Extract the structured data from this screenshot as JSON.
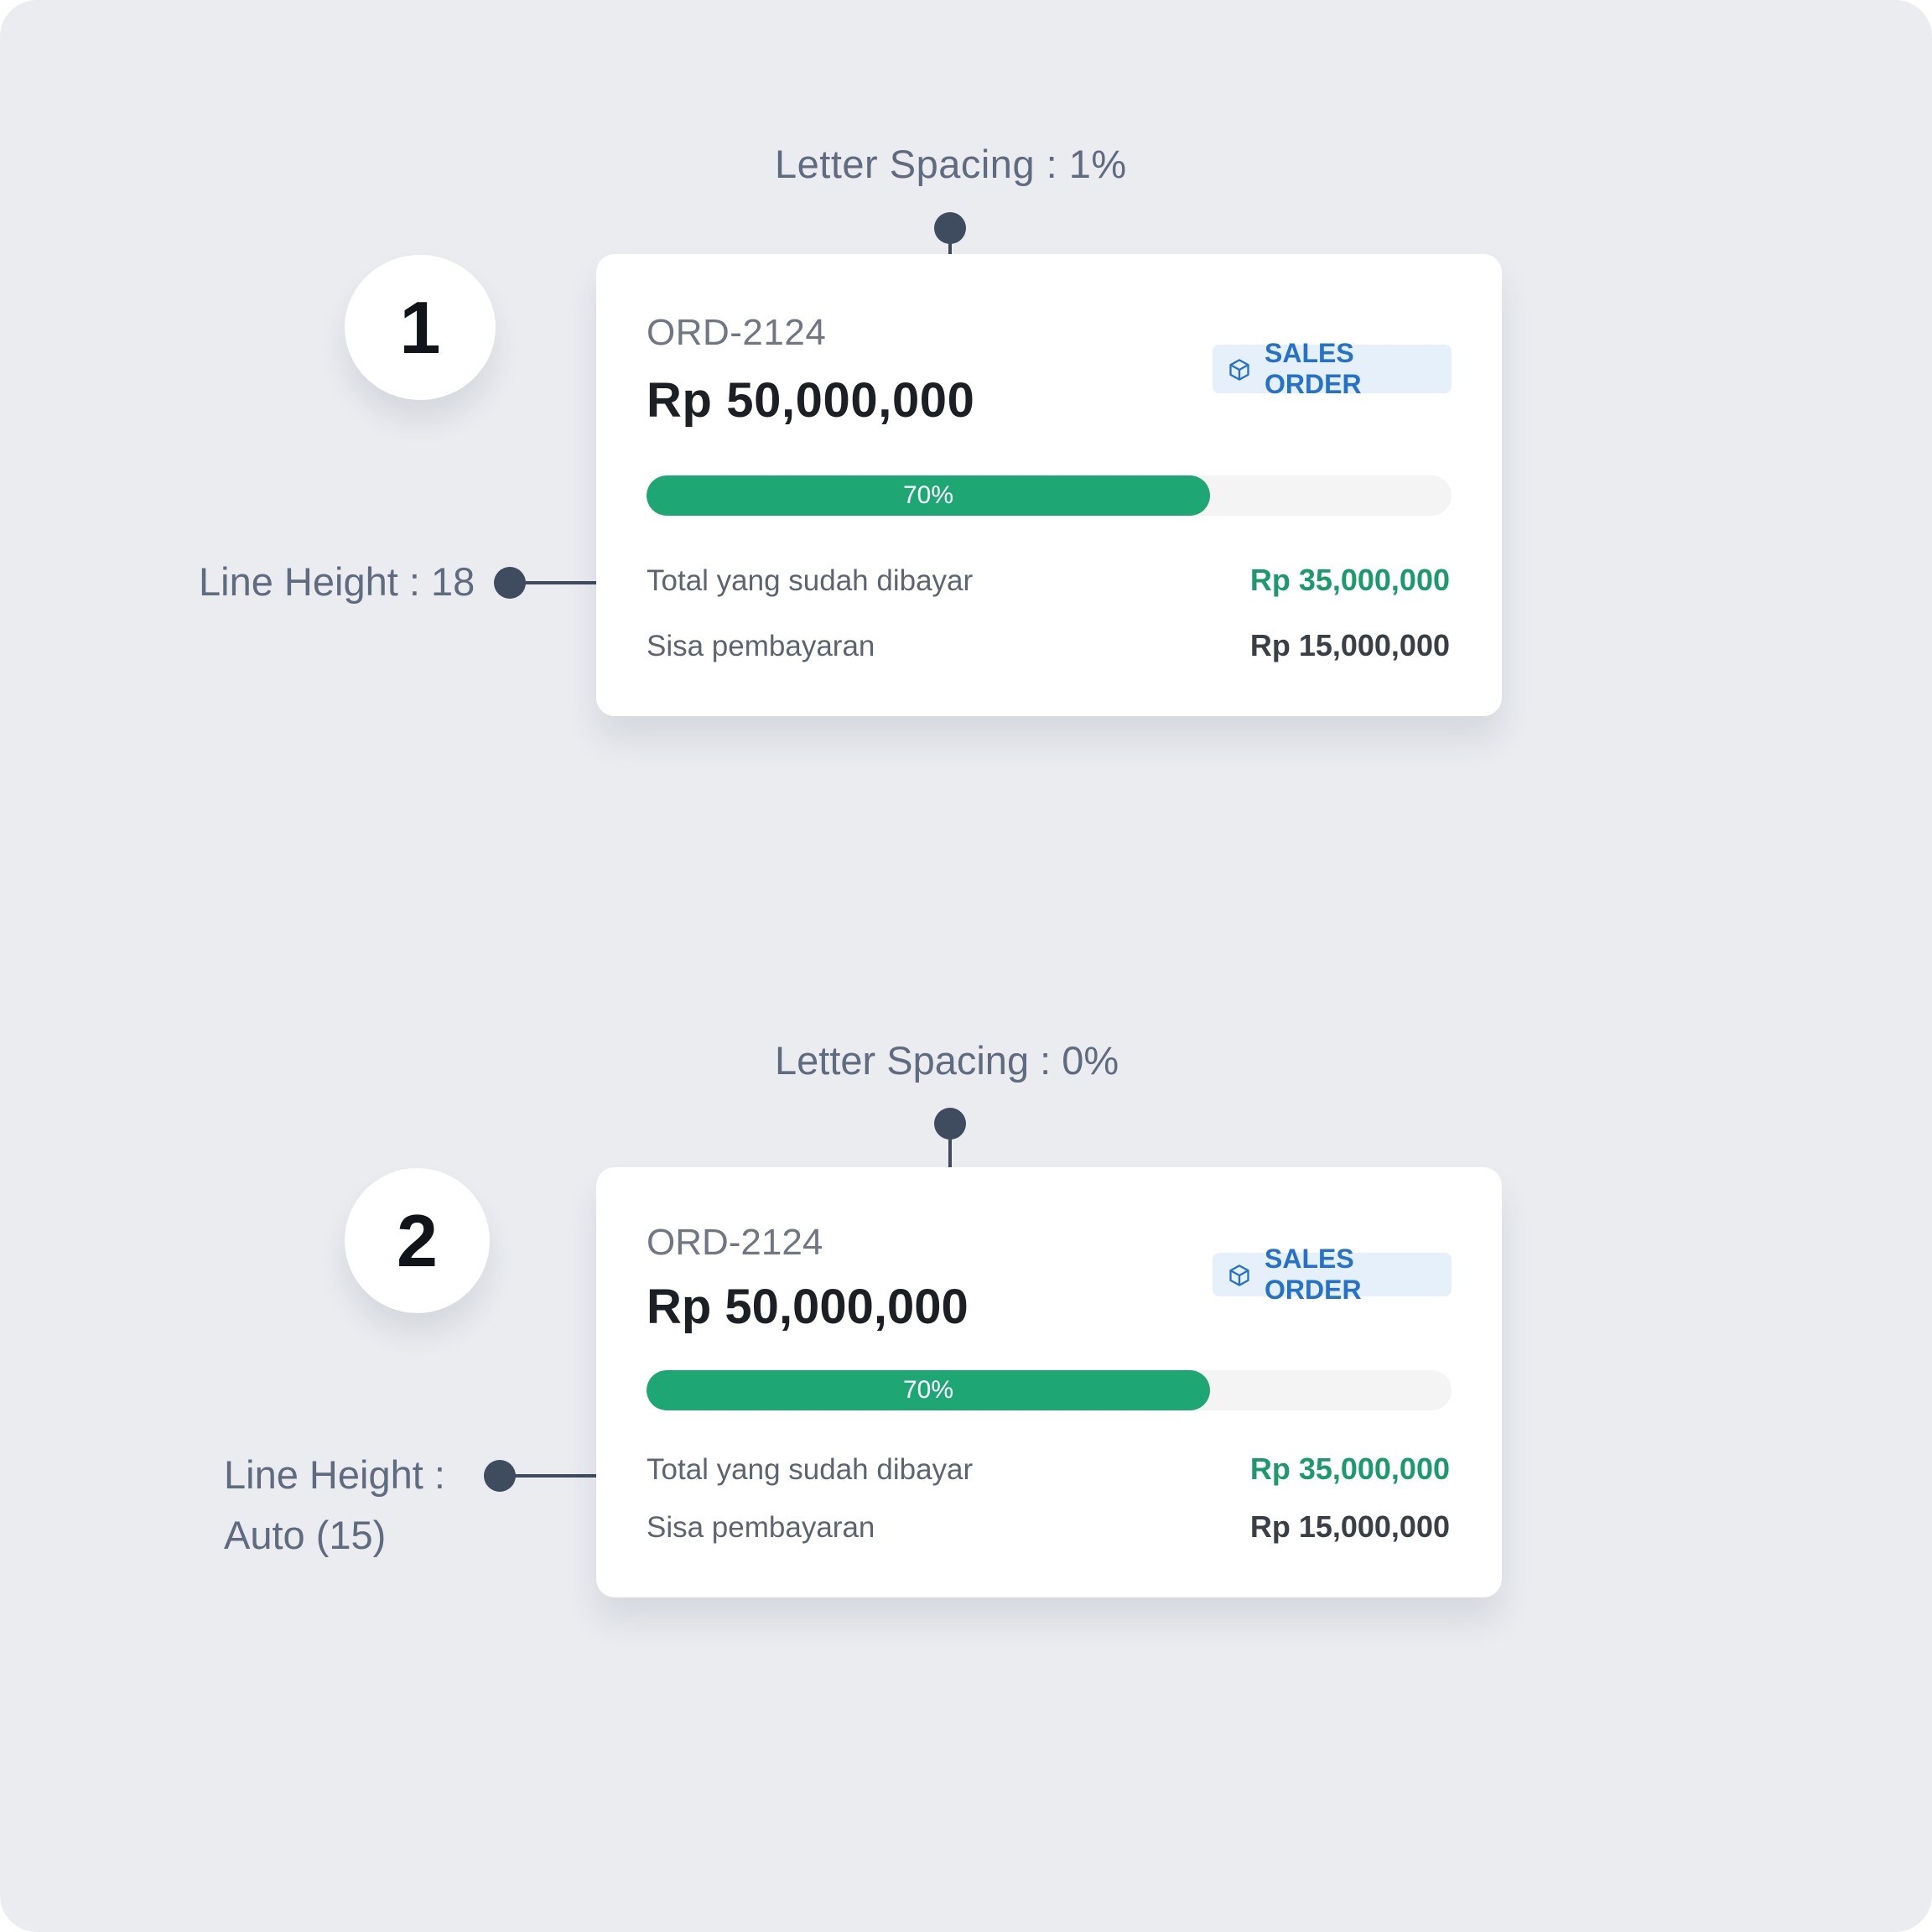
{
  "colors": {
    "background": "#eaecf0",
    "card": "#ffffff",
    "progress_fill": "#1fa675",
    "progress_track": "#f4f4f5",
    "badge_bg": "#e6f0fb",
    "badge_text": "#2672c8",
    "paid_value": "#1d9a6c",
    "annotation_text": "#5f6b7e",
    "connector": "#3f4b5e"
  },
  "examples": [
    {
      "number": "1",
      "letter_spacing_note": "Letter Spacing : 1%",
      "line_height_note": "Line Height : 18",
      "card": {
        "order_id": "ORD-2124",
        "amount": "Rp 50,000,000",
        "badge": {
          "icon": "box-icon",
          "label": "SALES ORDER"
        },
        "progress": {
          "fraction": 0.7,
          "label": "70%"
        },
        "rows": [
          {
            "label": "Total yang sudah dibayar",
            "value": "Rp 35,000,000"
          },
          {
            "label": "Sisa pembayaran",
            "value": "Rp 15,000,000"
          }
        ]
      }
    },
    {
      "number": "2",
      "letter_spacing_note": "Letter Spacing : 0%",
      "line_height_note_line1": "Line Height :",
      "line_height_note_line2": "Auto (15)",
      "card": {
        "order_id": "ORD-2124",
        "amount": "Rp 50,000,000",
        "badge": {
          "icon": "box-icon",
          "label": "SALES ORDER"
        },
        "progress": {
          "fraction": 0.7,
          "label": "70%"
        },
        "rows": [
          {
            "label": "Total yang sudah dibayar",
            "value": "Rp 35,000,000"
          },
          {
            "label": "Sisa pembayaran",
            "value": "Rp 15,000,000"
          }
        ]
      }
    }
  ]
}
